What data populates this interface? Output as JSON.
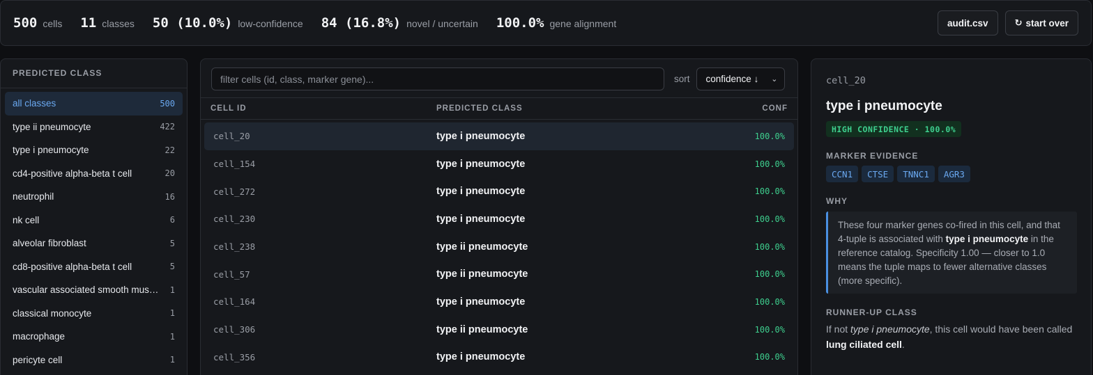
{
  "stats": [
    {
      "value": "500",
      "label": "cells"
    },
    {
      "value": "11",
      "label": "classes"
    },
    {
      "value": "50 (10.0%)",
      "label": "low-confidence"
    },
    {
      "value": "84 (16.8%)",
      "label": "novel / uncertain"
    },
    {
      "value": "100.0%",
      "label": "gene alignment"
    }
  ],
  "toolbar": {
    "audit_label": "audit.csv",
    "start_over_label": "start over",
    "start_over_icon": "refresh-icon"
  },
  "sidebar": {
    "heading": "PREDICTED CLASS",
    "items": [
      {
        "label": "all classes",
        "count": "500"
      },
      {
        "label": "type ii pneumocyte",
        "count": "422"
      },
      {
        "label": "type i pneumocyte",
        "count": "22"
      },
      {
        "label": "cd4-positive alpha-beta t cell",
        "count": "20"
      },
      {
        "label": "neutrophil",
        "count": "16"
      },
      {
        "label": "nk cell",
        "count": "6"
      },
      {
        "label": "alveolar fibroblast",
        "count": "5"
      },
      {
        "label": "cd8-positive alpha-beta t cell",
        "count": "5"
      },
      {
        "label": "vascular associated smooth mus…",
        "count": "1"
      },
      {
        "label": "classical monocyte",
        "count": "1"
      },
      {
        "label": "macrophage",
        "count": "1"
      },
      {
        "label": "pericyte cell",
        "count": "1"
      }
    ]
  },
  "table": {
    "filter_placeholder": "filter cells (id, class, marker gene)...",
    "sort_label": "sort",
    "sort_value": "confidence ↓",
    "columns": [
      "CELL ID",
      "PREDICTED CLASS",
      "CONF"
    ],
    "rows": [
      {
        "id": "cell_20",
        "class": "type i pneumocyte",
        "conf": "100.0%"
      },
      {
        "id": "cell_154",
        "class": "type i pneumocyte",
        "conf": "100.0%"
      },
      {
        "id": "cell_272",
        "class": "type i pneumocyte",
        "conf": "100.0%"
      },
      {
        "id": "cell_230",
        "class": "type i pneumocyte",
        "conf": "100.0%"
      },
      {
        "id": "cell_238",
        "class": "type ii pneumocyte",
        "conf": "100.0%"
      },
      {
        "id": "cell_57",
        "class": "type ii pneumocyte",
        "conf": "100.0%"
      },
      {
        "id": "cell_164",
        "class": "type i pneumocyte",
        "conf": "100.0%"
      },
      {
        "id": "cell_306",
        "class": "type ii pneumocyte",
        "conf": "100.0%"
      },
      {
        "id": "cell_356",
        "class": "type i pneumocyte",
        "conf": "100.0%"
      }
    ]
  },
  "detail": {
    "cell_id": "cell_20",
    "title": "type i pneumocyte",
    "badge": "HIGH CONFIDENCE · 100.0%",
    "marker_heading": "MARKER EVIDENCE",
    "markers": [
      "CCN1",
      "CTSE",
      "TNNC1",
      "AGR3"
    ],
    "why_heading": "WHY",
    "why_text_1": "These four marker genes co-fired in this cell, and that 4-tuple is associated with ",
    "why_bold": "type i pneumocyte",
    "why_text_2": " in the reference catalog. Specificity 1.00 — closer to 1.0 means the tuple maps to fewer alternative classes (more specific).",
    "runner_heading": "RUNNER-UP CLASS",
    "runner_text_1": "If not ",
    "runner_italic": "type i pneumocyte",
    "runner_text_2": ", this cell would have been called ",
    "runner_bold": "lung ciliated cell",
    "runner_text_3": "."
  },
  "colors": {
    "accent": "#6aa8f0",
    "success": "#3ecf8e",
    "background": "#0e0f12",
    "panel": "#16181c"
  }
}
